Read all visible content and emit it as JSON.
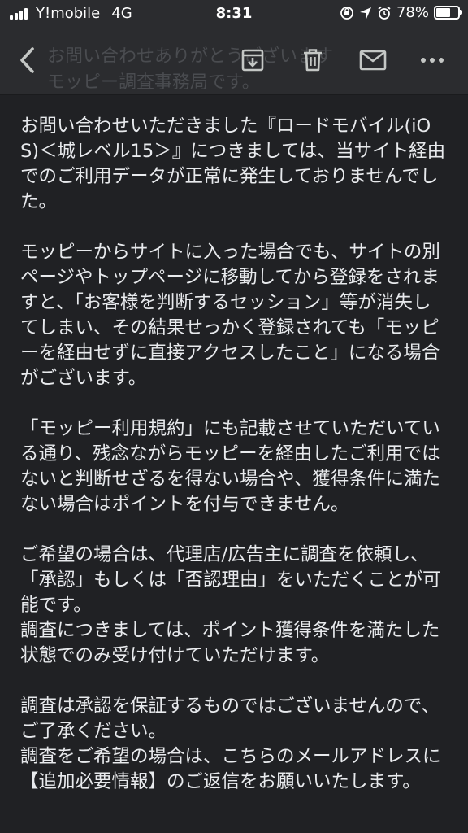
{
  "status_bar": {
    "carrier": "Y!mobile",
    "network": "4G",
    "time": "8:31",
    "battery_percent": "78%",
    "battery_level": 0.78
  },
  "toolbar": {
    "back_icon": "chevron-left-icon",
    "archive_icon": "archive-icon",
    "delete_icon": "trash-icon",
    "mark_unread_icon": "mail-icon",
    "more_icon": "more-horizontal-icon",
    "subject_preview": "お問い合わせありがとうございます\nモッピー調査事務局です。"
  },
  "message": {
    "paragraphs": [
      "お問い合わせいただきました『ロードモバイル(iOS)＜城レベル15＞』につきましては、当サイト経由でのご利用データが正常に発生しておりませんでした。",
      "モッピーからサイトに入った場合でも、サイトの別ページやトップページに移動してから登録をされますと、「お客様を判断するセッション」等が消失してしまい、その結果せっかく登録されても「モッピーを経由せずに直接アクセスしたこと」になる場合がございます。",
      "「モッピー利用規約」にも記載させていただいている通り、残念ながらモッピーを経由したご利用ではないと判断せざるを得ない場合や、獲得条件に満たない場合はポイントを付与できません。",
      "ご希望の場合は、代理店/広告主に調査を依頼し、「承認」もしくは「否認理由」をいただくことが可能です。\n調査につきましては、ポイント獲得条件を満たした状態でのみ受け付けていただけます。",
      "調査は承認を保証するものではございませんので、ご了承ください。\n調査をご希望の場合は、こちらのメールアドレスに【追加必要情報】のご返信をお願いいたします。"
    ]
  },
  "colors": {
    "background": "#202124",
    "toolbar": "#2b2c2f",
    "text": "#e8eaed",
    "icon": "#c4c7c5"
  }
}
